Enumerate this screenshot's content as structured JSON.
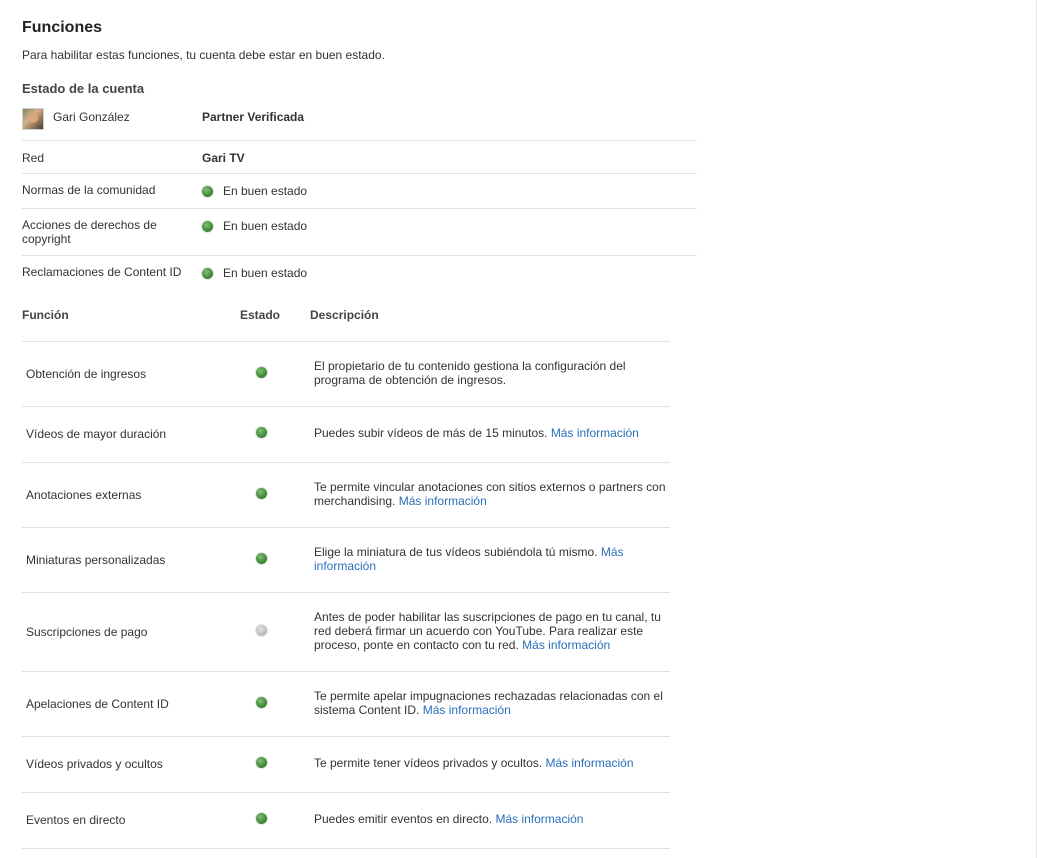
{
  "page": {
    "title": "Funciones",
    "subtitle": "Para habilitar estas funciones, tu cuenta debe estar en buen estado."
  },
  "account": {
    "heading": "Estado de la cuenta",
    "user_name": "Gari González",
    "user_status": "Partner Verificada",
    "network_label": "Red",
    "network_value": "Gari TV",
    "rows": [
      {
        "label": "Normas de la comunidad",
        "status": "En buen estado"
      },
      {
        "label": "Acciones de derechos de copyright",
        "status": "En buen estado"
      },
      {
        "label": "Reclamaciones de Content ID",
        "status": "En buen estado"
      }
    ]
  },
  "features": {
    "headers": {
      "function": "Función",
      "status": "Estado",
      "description": "Descripción"
    },
    "link_label": "Más información",
    "rows": [
      {
        "name": "Obtención de ingresos",
        "status": "green",
        "description": "El propietario de tu contenido gestiona la configuración del programa de obtención de ingresos.",
        "link": ""
      },
      {
        "name": "Vídeos de mayor duración",
        "status": "green",
        "description": "Puedes subir vídeos de más de 15 minutos.",
        "link": "Más información"
      },
      {
        "name": "Anotaciones externas",
        "status": "green",
        "description": "Te permite vincular anotaciones con sitios externos o partners con merchandising.",
        "link": "Más información"
      },
      {
        "name": "Miniaturas personalizadas",
        "status": "green",
        "description": "Elige la miniatura de tus vídeos subiéndola tú mismo.",
        "link": "Más información"
      },
      {
        "name": "Suscripciones de pago",
        "status": "grey",
        "description": "Antes de poder habilitar las suscripciones de pago en tu canal, tu red deberá firmar un acuerdo con YouTube. Para realizar este proceso, ponte en contacto con tu red.",
        "link": "Más información"
      },
      {
        "name": "Apelaciones de Content ID",
        "status": "green",
        "description": "Te permite apelar impugnaciones rechazadas relacionadas con el sistema Content ID.",
        "link": "Más información"
      },
      {
        "name": "Vídeos privados y ocultos",
        "status": "green",
        "description": "Te permite tener vídeos privados y ocultos.",
        "link": "Más información"
      },
      {
        "name": "Eventos en directo",
        "status": "green",
        "description": "Puedes emitir eventos en directo.",
        "link": "Más información"
      }
    ]
  },
  "colors": {
    "status_green": "#3f8a36",
    "status_grey": "#bdbdbd",
    "link": "#2a6ebb"
  }
}
